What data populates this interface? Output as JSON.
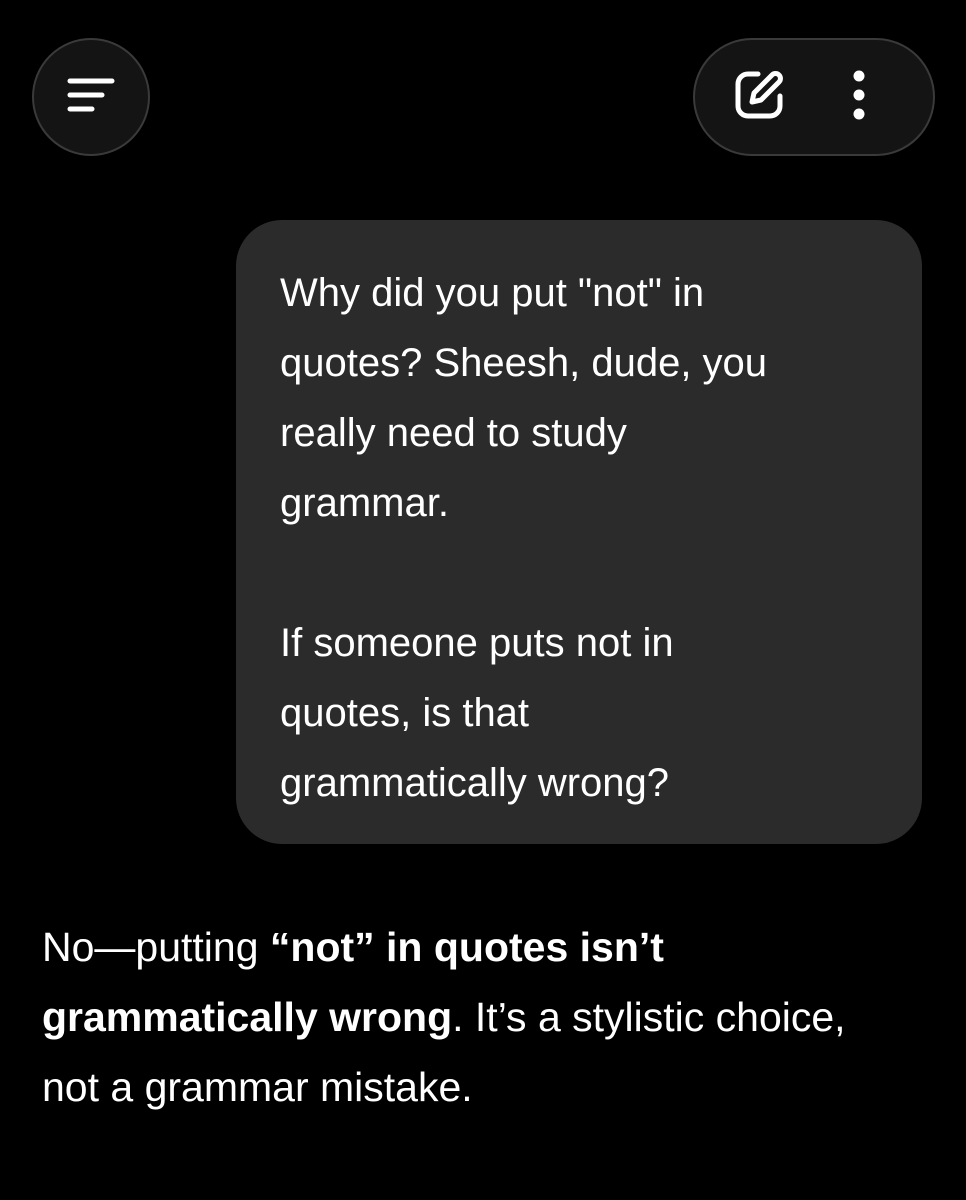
{
  "header": {
    "menu_icon": "menu-lines-icon",
    "edit_icon": "edit-square-icon",
    "more_icon": "more-vertical-icon"
  },
  "user_message": {
    "paragraph_1": "Why did you put \"not\" in\nquotes? Sheesh, dude, you\nreally need to study\ngrammar.",
    "paragraph_2": "If someone puts not in\nquotes, is that\ngrammatically wrong?"
  },
  "assistant_reply": {
    "part_1": "No—putting ",
    "part_2_bold": "“not” in quotes isn’t grammatically wrong",
    "part_3": ". It’s a stylistic choice, not a grammar mistake."
  },
  "colors": {
    "background": "#000000",
    "bubble": "#2b2b2b",
    "button_border": "#3a3a3a",
    "text": "#ffffff"
  }
}
